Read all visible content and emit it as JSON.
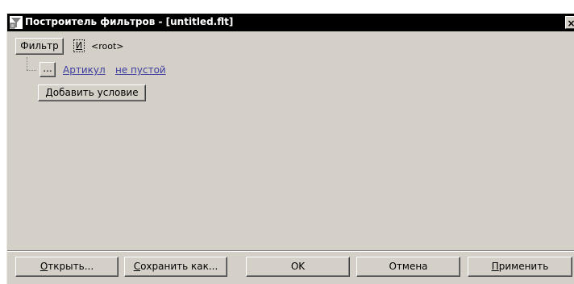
{
  "window": {
    "title": "Построитель фильтров - [untitled.flt]",
    "close_glyph": "×"
  },
  "filter": {
    "filter_button": "Фильтр",
    "operator": "И",
    "root_label": "<root>",
    "ellipsis_button": "...",
    "condition": {
      "field": "Артикул",
      "operator": "не пустой"
    },
    "add_condition_button": "Добавить условие"
  },
  "footer": {
    "open": {
      "hotkey": "О",
      "rest": "ткрыть..."
    },
    "save": {
      "hotkey": "С",
      "rest": "охранить как..."
    },
    "ok": "OK",
    "cancel": "Отмена",
    "apply": {
      "hotkey": "П",
      "rest": "рименить"
    }
  },
  "colors": {
    "face": "#d4d0c8",
    "title_bar": "#000000",
    "link": "#3c3ca0"
  }
}
